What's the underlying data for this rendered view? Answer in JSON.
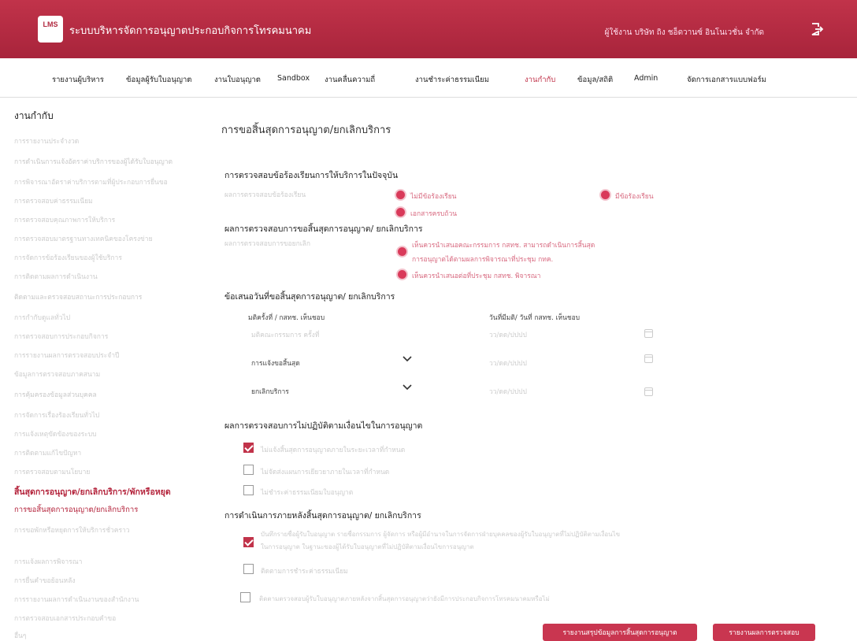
{
  "header": {
    "logo_text": "LMS",
    "title": "ระบบบริหารจัดการอนุญาตประกอบกิจการโทรคมนาคม",
    "user": "ผู้ใช้งาน บริษัท ถิง ชอ็ดวานซ์ อินโนเวชั่น จำกัด"
  },
  "nav": [
    {
      "label": "รายงานผู้บริหาร"
    },
    {
      "label": "ข้อมูลผู้รับใบอนุญาต"
    },
    {
      "label": "งานใบอนุญาต"
    },
    {
      "label": "Sandbox"
    },
    {
      "label": "งานคลื่นความถี่"
    },
    {
      "label": "งานชำระค่าธรรมเนียม"
    },
    {
      "label": "งานกำกับ"
    },
    {
      "label": "ข้อมูล/สถิติ"
    },
    {
      "label": "Admin"
    },
    {
      "label": "จัดการเอกสารแบบฟอร์ม"
    }
  ],
  "sidebar": {
    "heading": "งานกำกับ",
    "items": [
      "การรายงานประจำงวด",
      "การดำเนินการแจ้งอัตราค่าบริการของผู้ได้รับใบอนุญาต",
      "การพิจารณาอัตราค่าบริการตามที่ผู้ประกอบการยื่นขอ",
      "การตรวจสอบค่าธรรมเนียม",
      "การตรวจสอบคุณภาพการให้บริการ",
      "การตรวจสอบมาตรฐานทางเทคนิคของโครงข่าย",
      "การจัดการข้อร้องเรียนของผู้ใช้บริการ",
      "การติดตามผลการดำเนินงาน",
      "ติดตามและตรวจสอบสถานะการประกอบการ",
      "การกำกับดูแลทั่วไป",
      "การตรวจสอบการประกอบกิจการ",
      "การรายงานผลการตรวจสอบประจำปี",
      "ข้อมูลการตรวจสอบภาคสนาม",
      "การคุ้มครองข้อมูลส่วนบุคคล",
      "การจัดการเรื่องร้องเรียนทั่วไป",
      "การแจ้งเหตุขัดข้องของระบบ",
      "การติดตามแก้ไขปัญหา",
      "การตรวจสอบตามนโยบาย",
      "สิ้นสุดการอนุญาต/ยกเลิกบริการ/พักหรือหยุด",
      "การขอสิ้นสุดการอนุญาต/ยกเลิกบริการ",
      "การขอพักหรือหยุดการให้บริการชั่วคราว",
      "การแจ้งผลการพิจารณา",
      "การยื่นคำขอย้อนหลัง",
      "การรายงานผลการดำเนินงานของสำนักงาน",
      "การตรวจสอบเอกสารประกอบคำขอ",
      "อื่นๆ"
    ]
  },
  "main": {
    "title": "การขอสิ้นสุดการอนุญาต/ยกเลิกบริการ",
    "complaint": {
      "heading": "การตรวจสอบข้อร้องเรียนการให้บริการในปัจจุบัน",
      "field_label": "ผลการตรวจสอบข้อร้องเรียน",
      "options": [
        "ไม่มีข้อร้องเรียน",
        "เอกสารครบถ้วน",
        "มีข้อร้องเรียน"
      ]
    },
    "result": {
      "heading": "ผลการตรวจสอบการขอสิ้นสุดการอนุญาต/ ยกเลิกบริการ",
      "field_label": "ผลการตรวจสอบการขอยกเลิก",
      "option1_line1": "เห็นควรนำเสนอคณะกรรมการ กสทช. สามารถดำเนินการสิ้นสุด",
      "option1_line2": "การอนุญาตได้ตามผลการพิจารณาที่ประชุม กทค.",
      "option2": "เห็นควรนำเสนอต่อที่ประชุม กสทช. พิจารณา"
    },
    "dates": {
      "heading": "ข้อเสนอวันที่ขอสิ้นสุดการอนุญาต/ ยกเลิกบริการ",
      "col1": "มติครั้งที่ / กสทช. เห็นชอบ",
      "col2": "วันที่มีมติ/ วันที่ กสทช. เห็นชอบ",
      "row0_input": "มติคณะกรรมการ ครั้งที่",
      "row0_date": "วว/ดด/ปปปป",
      "row1": "การแจ้งขอสิ้นสุด",
      "row1_date": "วว/ดด/ปปปป",
      "row2": "ยกเลิกบริการ",
      "row2_date": "วว/ดด/ปปปป"
    },
    "compliance": {
      "heading": "ผลการตรวจสอบการไม่ปฏิบัติตามเงื่อนไขในการอนุญาต",
      "checks": [
        {
          "label": "ไม่แจ้งสิ้นสุดการอนุญาตภายในระยะเวลาที่กำหนด",
          "checked": true
        },
        {
          "label": "ไม่จัดส่งแผนการเยียวยาภายในเวลาที่กำหนด",
          "checked": false
        },
        {
          "label": "ไม่ชำระค่าธรรมเนียมใบอนุญาต",
          "checked": false
        }
      ]
    },
    "actions": {
      "heading": "การดำเนินการภายหลังสิ้นสุดการอนุญาต/ ยกเลิกบริการ",
      "check1_line1": "บันทึกรายชื่อผู้รับใบอนุญาต รายชื่อกรรมการ ผู้จัดการ หรือผู้มีอำนาจในการจัดการฝ่ายบุคคลของผู้รับใบอนุญาตที่ไม่ปฏิบัติตามเงื่อนไข",
      "check1_line2": "ในการอนุญาต ในฐานะของผู้ได้รับใบอนุญาตที่ไม่ปฏิบัติตามเงื่อนไขการอนุญาต",
      "check1_checked": true,
      "check2": "ติดตามการชำระค่าธรรมเนียม",
      "check2_checked": false,
      "check3": "ติดตามตรวจสอบผู้รับใบอนุญาตภายหลังจากสิ้นสุดการอนุญาตว่ายังมีการประกอบกิจการโทรคมนาคมหรือไม่",
      "check3_checked": false
    },
    "buttons": {
      "summary": "รายงานสรุปข้อมูลการสิ้นสุดการอนุญาต",
      "report": "รายงานผลการตรวจสอบ"
    }
  },
  "colors": {
    "brand": "#c1334a",
    "accent": "#d93a5a"
  }
}
